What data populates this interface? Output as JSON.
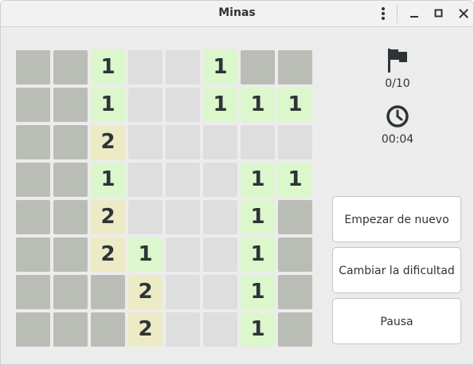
{
  "window": {
    "title": "Minas"
  },
  "sidebar": {
    "flags_icon": "flag-icon",
    "flags_counter": "0/10",
    "clock_icon": "clock-icon",
    "time": "00:04"
  },
  "buttons": {
    "restart": "Empezar de nuevo",
    "difficulty": "Cambiar la dificultad",
    "pause": "Pausa"
  },
  "colors": {
    "covered": "#babdb6",
    "cleared": "#dedede",
    "number_1": "#dcf7cc",
    "number_2": "#ecebc6"
  },
  "board": {
    "columns": 8,
    "rows": 8,
    "cells": [
      [
        "covered",
        "covered",
        "1",
        "cleared",
        "cleared",
        "1",
        "covered",
        "covered"
      ],
      [
        "covered",
        "covered",
        "1",
        "cleared",
        "cleared",
        "1",
        "1",
        "1"
      ],
      [
        "covered",
        "covered",
        "2",
        "cleared",
        "cleared",
        "cleared",
        "cleared",
        "cleared"
      ],
      [
        "covered",
        "covered",
        "1",
        "cleared",
        "cleared",
        "cleared",
        "1",
        "1"
      ],
      [
        "covered",
        "covered",
        "2",
        "cleared",
        "cleared",
        "cleared",
        "1",
        "covered"
      ],
      [
        "covered",
        "covered",
        "2",
        "1",
        "cleared",
        "cleared",
        "1",
        "covered"
      ],
      [
        "covered",
        "covered",
        "covered",
        "2",
        "cleared",
        "cleared",
        "1",
        "covered"
      ],
      [
        "covered",
        "covered",
        "covered",
        "2",
        "cleared",
        "cleared",
        "1",
        "covered"
      ]
    ]
  }
}
